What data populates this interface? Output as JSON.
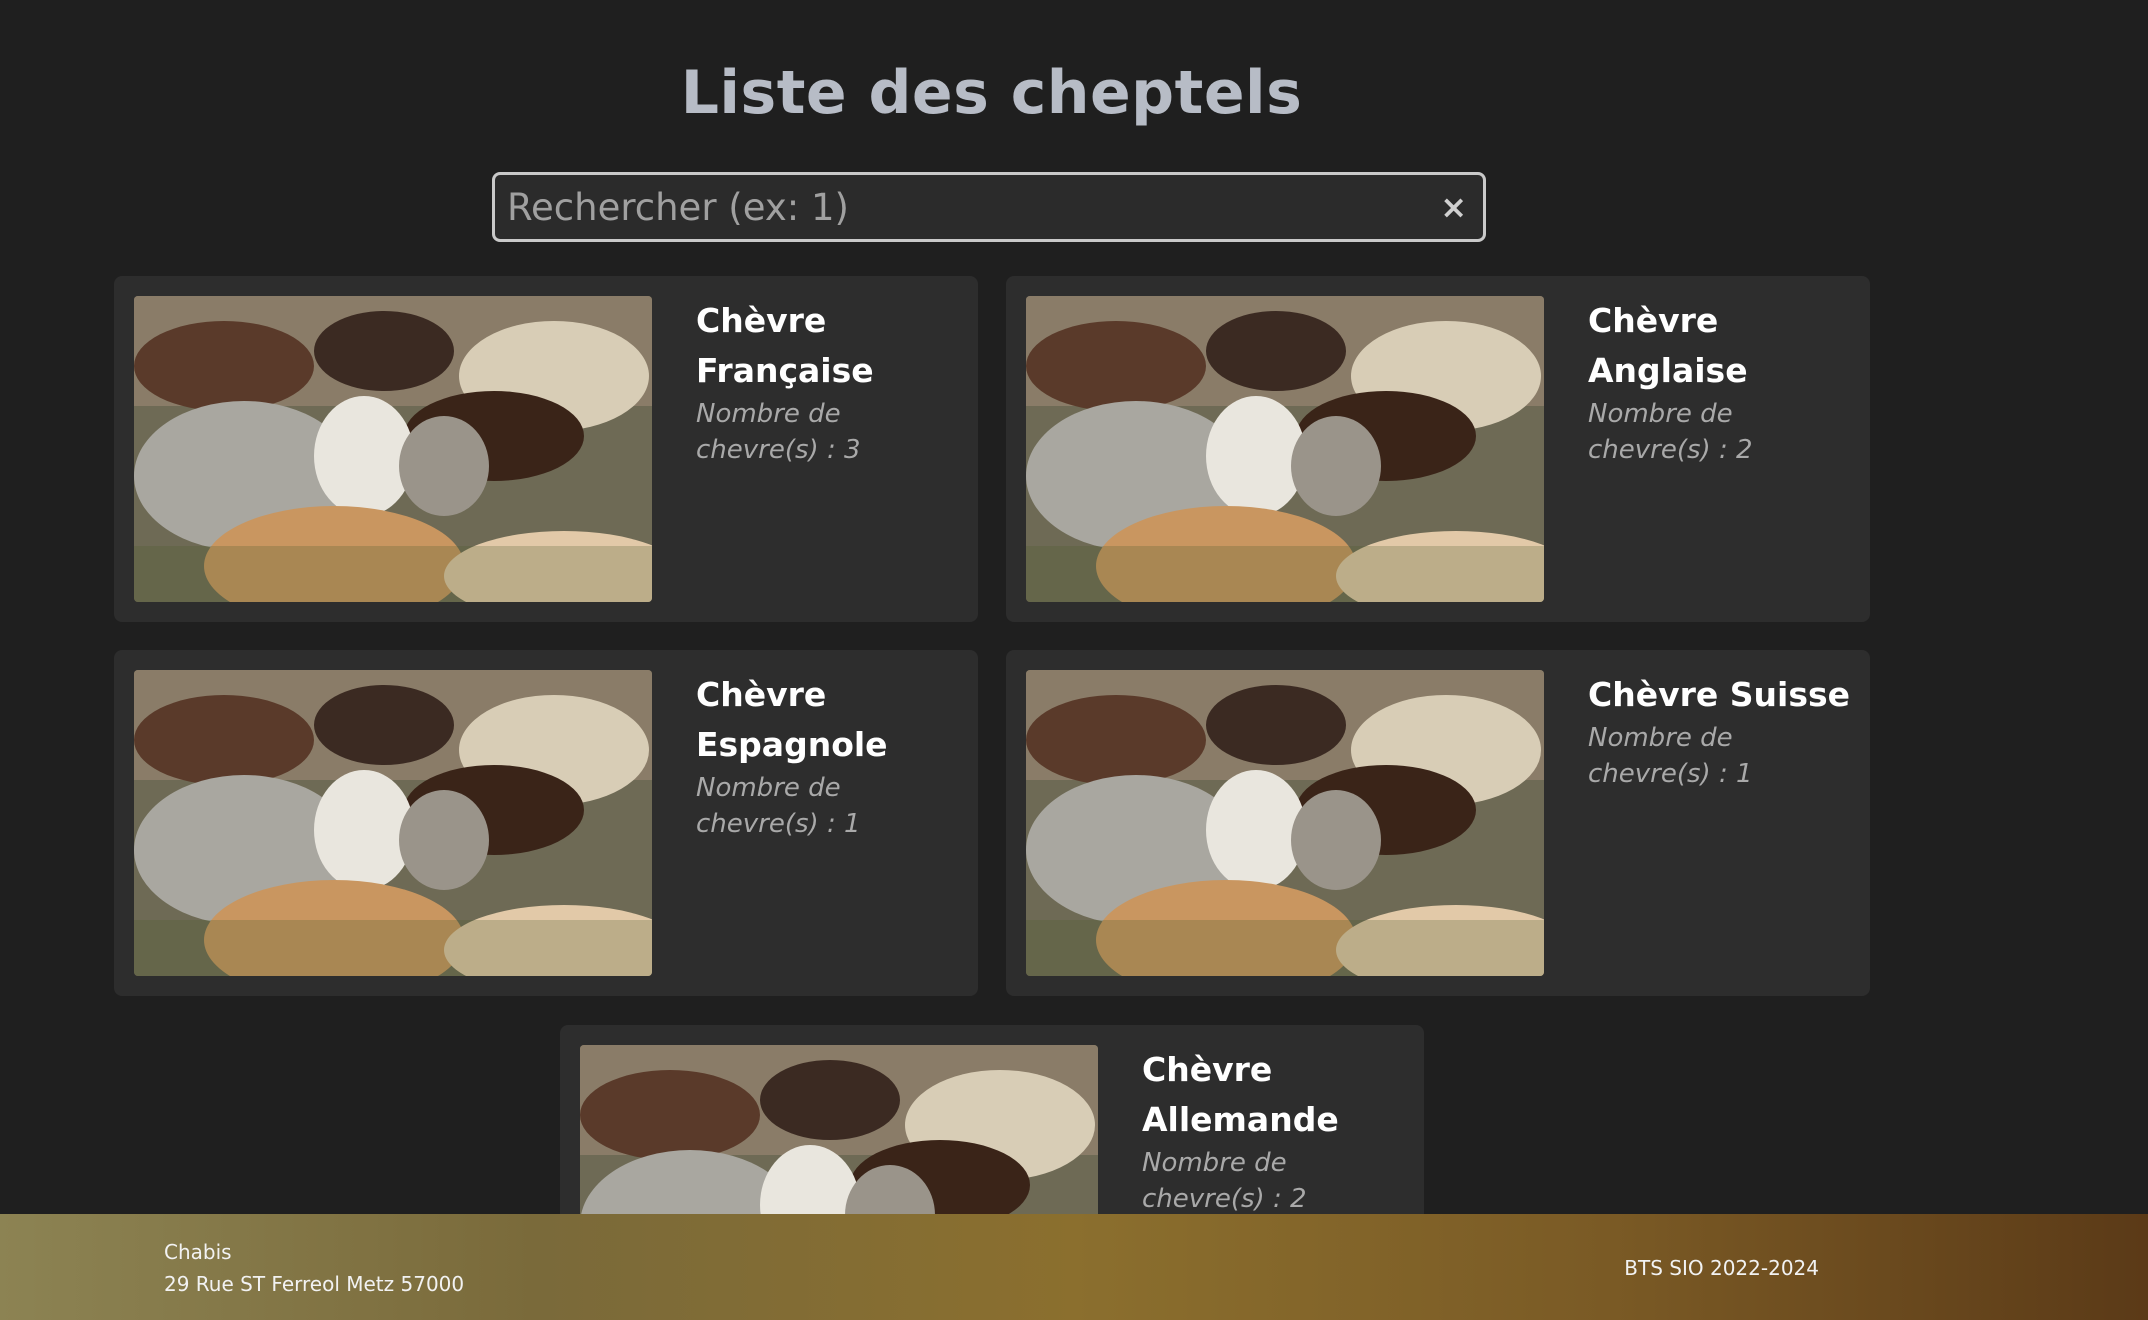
{
  "page": {
    "title": "Liste des cheptels"
  },
  "search": {
    "placeholder": "Rechercher (ex: 1)",
    "value": "",
    "clear_glyph": "×",
    "clear_icon": "close-icon"
  },
  "cheptels": [
    {
      "name": "Chèvre Française",
      "count_label": "Nombre de chevre(s) : 3",
      "count": 3
    },
    {
      "name": "Chèvre Anglaise",
      "count_label": "Nombre de chevre(s) : 2",
      "count": 2
    },
    {
      "name": "Chèvre Espagnole",
      "count_label": "Nombre de chevre(s) : 1",
      "count": 1
    },
    {
      "name": "Chèvre Suisse",
      "count_label": "Nombre de chevre(s) : 1",
      "count": 1
    },
    {
      "name": "Chèvre Allemande",
      "count_label": "Nombre de chevre(s) : 2",
      "count": 2
    }
  ],
  "footer": {
    "company": "Chabis",
    "address": "29 Rue ST Ferreol Metz 57000",
    "credits": "BTS SIO 2022-2024"
  },
  "colors": {
    "background": "#1f1f1f",
    "card": "#2d2d2d",
    "title": "#b7bcc6",
    "footer_start": "#8c8353",
    "footer_end": "#5b3a17"
  }
}
